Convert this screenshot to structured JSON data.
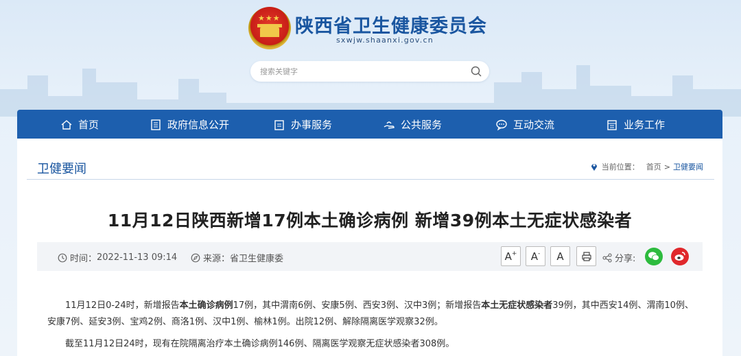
{
  "header": {
    "site_title": "陕西省卫生健康委员会",
    "site_url": "sxwjw.shaanxi.gov.cn"
  },
  "search": {
    "placeholder": "搜索关键字"
  },
  "nav": {
    "items": [
      {
        "label": "首页",
        "icon": "home-icon"
      },
      {
        "label": "政府信息公开",
        "icon": "document-list-icon"
      },
      {
        "label": "办事服务",
        "icon": "clipboard-icon"
      },
      {
        "label": "公共服务",
        "icon": "hand-service-icon"
      },
      {
        "label": "互动交流",
        "icon": "chat-icon"
      },
      {
        "label": "业务工作",
        "icon": "briefcase-icon"
      }
    ]
  },
  "section": {
    "title": "卫健要闻",
    "breadcrumb_label": "当前位置：",
    "breadcrumb_home": "首页",
    "breadcrumb_sep": ">",
    "breadcrumb_current": "卫健要闻"
  },
  "article": {
    "title": "11月12日陕西新增17例本土确诊病例 新增39例本土无症状感染者",
    "time_label": "时间：",
    "time_value": "2022-11-13 09:14",
    "source_label": "来源：",
    "source_value": "省卫生健康委",
    "font_buttons": [
      "A+",
      "A-",
      "A"
    ],
    "share_label": "分享:",
    "p1_a": "11月12日0-24时，新增报告",
    "p1_b": "本土确诊病例",
    "p1_c": "17例，其中渭南6例、安康5例、西安3例、汉中3例；新增报告",
    "p1_d": "本土无症状感染者",
    "p1_e": "39例，其中西安14例、渭南10例、安康7例、延安3例、宝鸡2例、商洛1例、汉中1例、榆林1例。出院12例、解除隔离医学观察32例。",
    "p2": "截至11月12日24时，现有在院隔离治疗本土确诊病例146例、隔离医学观察无症状感染者308例。"
  },
  "colors": {
    "brand_blue": "#1d5fae",
    "title_blue": "#1a56a0",
    "wechat_green": "#2dbb3e",
    "weibo_red": "#e0282c"
  }
}
